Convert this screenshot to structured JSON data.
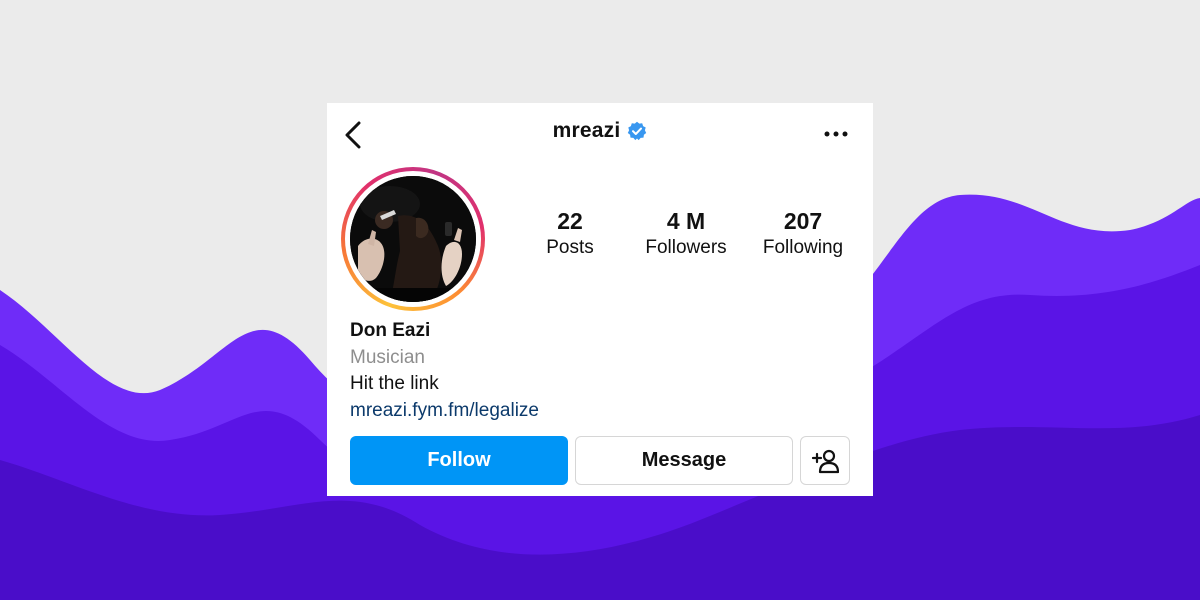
{
  "colors": {
    "page_background": "#ebebeb",
    "wave_light": "#6f2cf8",
    "wave_mid": "#5a14e6",
    "wave_dark": "#4a0dc9",
    "follow_button": "#0095f6",
    "link": "#0c3a6b",
    "verified_badge": "#3897f0"
  },
  "header": {
    "back_icon": "chevron-left-icon",
    "username": "mreazi",
    "verified_icon": "verified-badge-icon",
    "more_icon": "more-horizontal-icon"
  },
  "stats": [
    {
      "value": "22",
      "label": "Posts"
    },
    {
      "value": "4 M",
      "label": "Followers"
    },
    {
      "value": "207",
      "label": "Following"
    }
  ],
  "bio": {
    "name": "Don Eazi",
    "category": "Musician",
    "text": "Hit the link",
    "link": "mreazi.fym.fm/legalize"
  },
  "actions": {
    "follow_label": "Follow",
    "message_label": "Message",
    "add_user_icon": "add-user-icon"
  }
}
